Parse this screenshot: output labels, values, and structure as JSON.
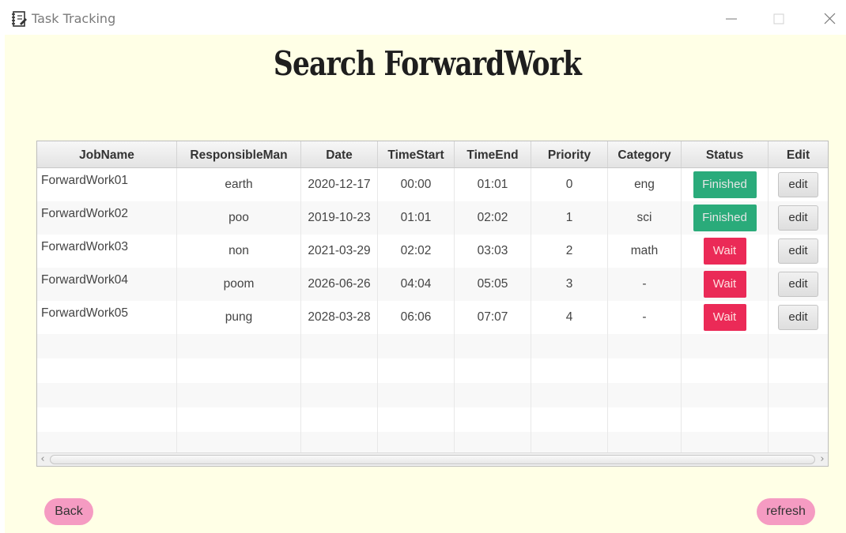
{
  "window": {
    "title": "Task Tracking",
    "icon": "notebook-icon",
    "controls": [
      "minimize-icon",
      "maximize-icon",
      "close-icon"
    ]
  },
  "page": {
    "heading": "Search ForwardWork"
  },
  "table": {
    "columns": [
      "JobName",
      "ResponsibleMan",
      "Date",
      "TimeStart",
      "TimeEnd",
      "Priority",
      "Category",
      "Status",
      "Edit"
    ],
    "rows": [
      {
        "job": "ForwardWork01",
        "man": "earth",
        "date": "2020-12-17",
        "start": "00:00",
        "end": "01:01",
        "priority": "0",
        "category": "eng",
        "status": "Finished",
        "edit": "edit"
      },
      {
        "job": "ForwardWork02",
        "man": "poo",
        "date": "2019-10-23",
        "start": "01:01",
        "end": "02:02",
        "priority": "1",
        "category": "sci",
        "status": "Finished",
        "edit": "edit"
      },
      {
        "job": "ForwardWork03",
        "man": "non",
        "date": "2021-03-29",
        "start": "02:02",
        "end": "03:03",
        "priority": "2",
        "category": "math",
        "status": "Wait",
        "edit": "edit"
      },
      {
        "job": "ForwardWork04",
        "man": "poom",
        "date": "2026-06-26",
        "start": "04:04",
        "end": "05:05",
        "priority": "3",
        "category": "-",
        "status": "Wait",
        "edit": "edit"
      },
      {
        "job": "ForwardWork05",
        "man": "pung",
        "date": "2028-03-28",
        "start": "06:06",
        "end": "07:07",
        "priority": "4",
        "category": "-",
        "status": "Wait",
        "edit": "edit"
      }
    ],
    "status_colors": {
      "Finished": "#1fa774",
      "Wait": "#ea1f4f"
    }
  },
  "buttons": {
    "back": "Back",
    "refresh": "refresh"
  },
  "colors": {
    "background": "#ffffe6",
    "pill_button": "#f59bc2"
  }
}
